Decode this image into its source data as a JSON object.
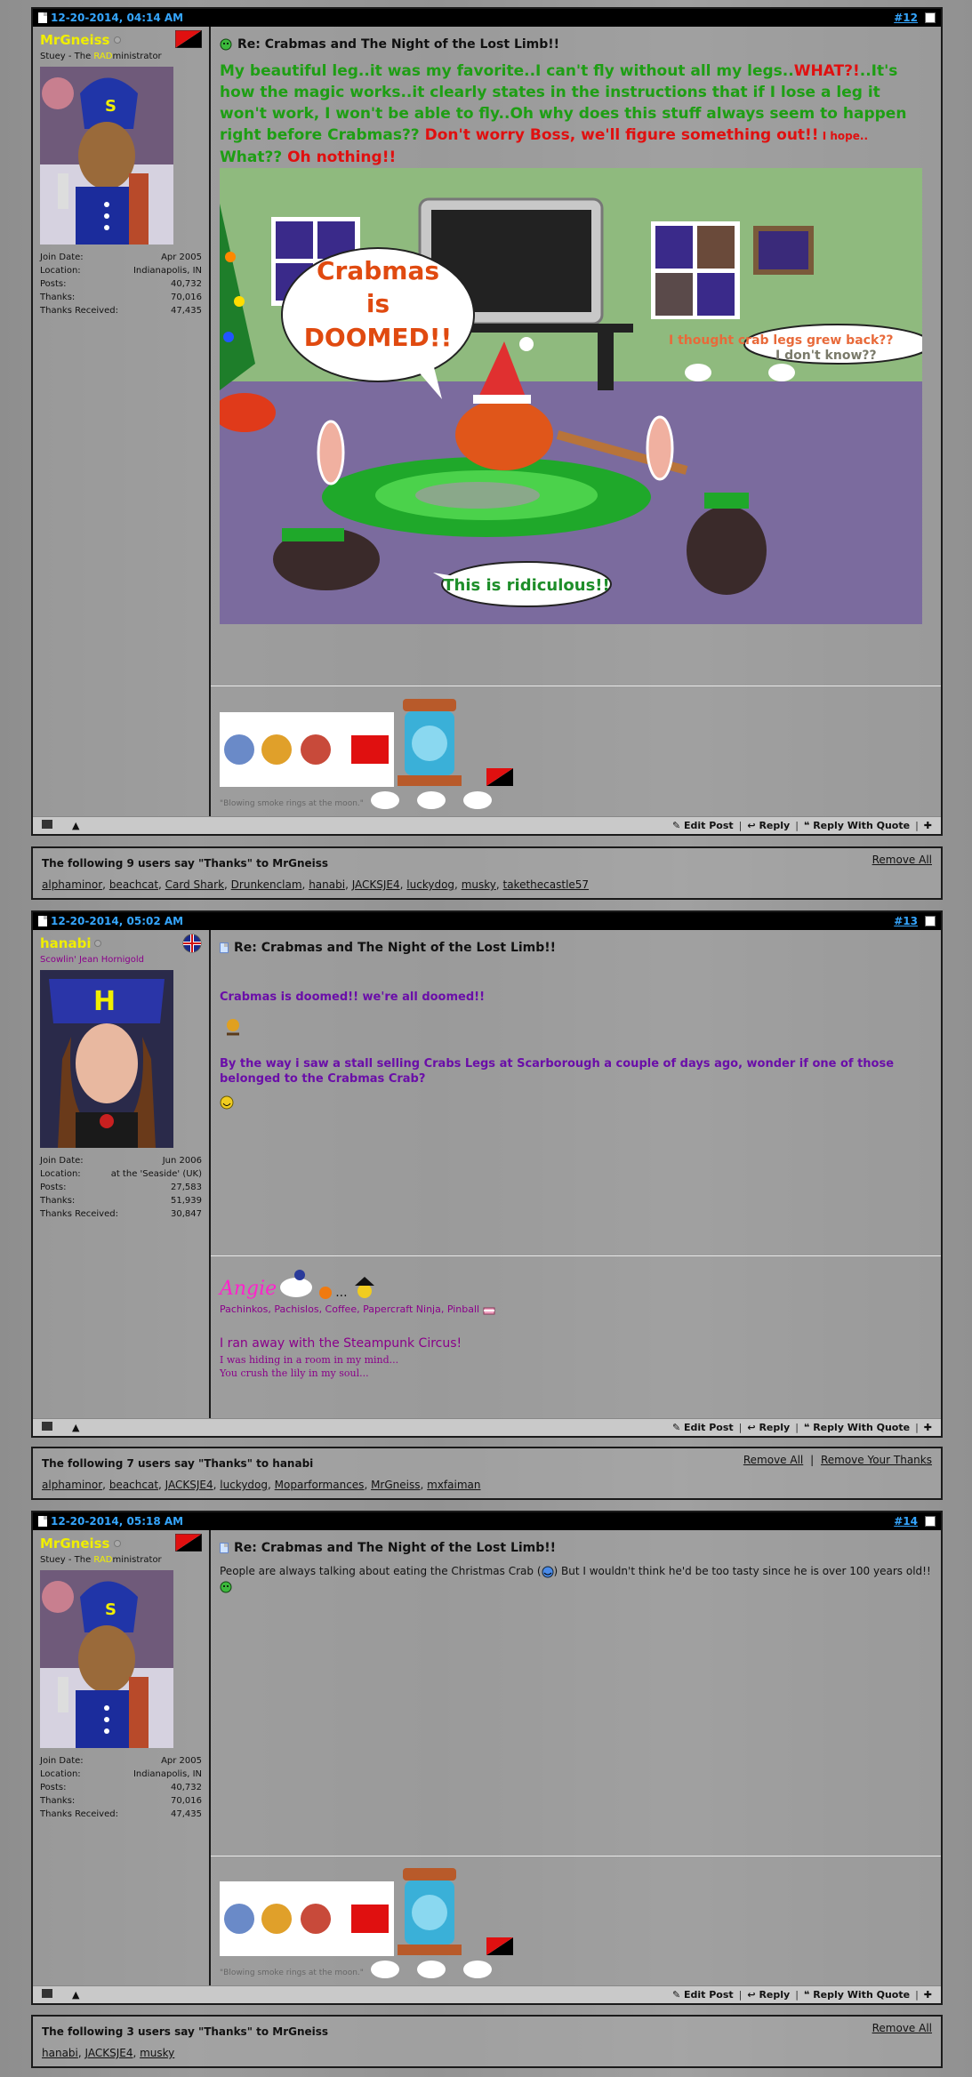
{
  "posts": [
    {
      "date": "12-20-2014, 04:14 AM",
      "number": "#12",
      "username": "MrGneiss",
      "title_pre": "Stuey - The ",
      "title_rad": "RAD",
      "title_post": "ministrator",
      "stats": [
        {
          "label": "Join Date:",
          "value": "Apr 2005"
        },
        {
          "label": "Location:",
          "value": "Indianapolis, IN"
        },
        {
          "label": "Posts:",
          "value": "40,732"
        },
        {
          "label": "Thanks:",
          "value": "70,016"
        },
        {
          "label": "Thanks Received:",
          "value": "47,435"
        }
      ],
      "post_title": "Re: Crabmas and The Night of the Lost Limb!!",
      "msg_green1": "My beautiful leg..it was my favorite..I can't fly without all my legs..",
      "msg_red1": "WHAT?!",
      "msg_green2": "..It's how the magic works..it clearly states in the instructions that if I lose a leg it won't work, I won't be able to fly..Oh why does this stuff always seem to happen right before Crabmas??",
      "msg_red2": " Don't worry Boss, we'll figure something out!!",
      "msg_red_small": " I hope..",
      "msg_green3": " What??",
      "msg_red3": " Oh nothing!!",
      "bubble_doomed_1": "Crabmas",
      "bubble_doomed_2": "is",
      "bubble_doomed_3": "DOOMED!!",
      "bubble_legs_1": "I thought crab legs grew back??",
      "bubble_legs_2": "I don't know??",
      "bubble_ridiculous": "This is ridiculous!!",
      "sig_quote": "\"Blowing smoke rings at the moon.\""
    },
    {
      "date": "12-20-2014, 05:02 AM",
      "number": "#13",
      "username": "hanabi",
      "title": "Scowlin' Jean Hornigold",
      "stats": [
        {
          "label": "Join Date:",
          "value": "Jun 2006"
        },
        {
          "label": "Location:",
          "value": "at the 'Seaside' (UK)"
        },
        {
          "label": "Posts:",
          "value": "27,583"
        },
        {
          "label": "Thanks:",
          "value": "51,939"
        },
        {
          "label": "Thanks Received:",
          "value": "30,847"
        }
      ],
      "post_title": "Re: Crabmas and The Night of the Lost Limb!!",
      "line1": "Crabmas is doomed!! we're all doomed!!",
      "line2": "By the way i saw a stall selling Crabs Legs at Scarborough a couple of days ago, wonder if one of those belonged to the Crabmas Crab?",
      "sig_name": "Angie",
      "sig_dots": "...",
      "sig_hobbies": "Pachinkos, Pachislos, Coffee, Papercraft Ninja, Pinball",
      "sig_steampunk": "I ran away with the Steampunk Circus!",
      "sig_line3": "I was hiding in a room in my mind...",
      "sig_line4": "You crush the lily in my soul..."
    },
    {
      "date": "12-20-2014, 05:18 AM",
      "number": "#14",
      "username": "MrGneiss",
      "title_pre": "Stuey - The ",
      "title_rad": "RAD",
      "title_post": "ministrator",
      "stats": [
        {
          "label": "Join Date:",
          "value": "Apr 2005"
        },
        {
          "label": "Location:",
          "value": "Indianapolis, IN"
        },
        {
          "label": "Posts:",
          "value": "40,732"
        },
        {
          "label": "Thanks:",
          "value": "70,016"
        },
        {
          "label": "Thanks Received:",
          "value": "47,435"
        }
      ],
      "post_title": "Re: Crabmas and The Night of the Lost Limb!!",
      "msg_a": "People are always talking about eating the Christmas Crab (",
      "msg_b": ") But I wouldn't think he'd be too tasty since he is over 100 years old!!",
      "sig_quote": "\"Blowing smoke rings at the moon.\""
    }
  ],
  "footer": {
    "edit": "Edit Post",
    "reply": "Reply",
    "reply_quote": "Reply With Quote"
  },
  "thanks": [
    {
      "header": "The following 9 users say \"Thanks\" to MrGneiss",
      "remove_all": "Remove All",
      "users": [
        "alphaminor",
        "beachcat",
        "Card Shark",
        "Drunkenclam",
        "hanabi",
        "JACKSJE4",
        "luckydog",
        "musky",
        "takethecastle57"
      ]
    },
    {
      "header": "The following 7 users say \"Thanks\" to hanabi",
      "remove_all": "Remove All",
      "remove_yours": "Remove Your Thanks",
      "users": [
        "alphaminor",
        "beachcat",
        "JACKSJE4",
        "luckydog",
        "Moparformances",
        "MrGneiss",
        "mxfaiman"
      ]
    },
    {
      "header": "The following 3 users say \"Thanks\" to MrGneiss",
      "remove_all": "Remove All",
      "users": [
        "hanabi",
        "JACKSJE4",
        "musky"
      ]
    }
  ],
  "colors": {
    "header_bg": "#000000",
    "date_blue": "#35a6ff",
    "username_yellow": "#f0ee00",
    "msg_green": "#1e9e14",
    "msg_red": "#e01010",
    "purple": "#6a0ea8",
    "angie_pink": "#ff22cc"
  }
}
